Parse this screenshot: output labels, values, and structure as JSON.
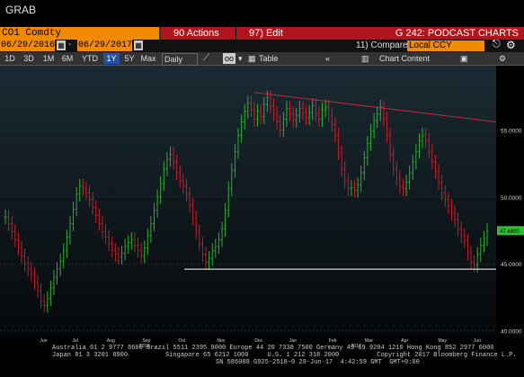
{
  "window": {
    "title": "GRAB"
  },
  "toolbar": {
    "ticker": "CO1 Comdty",
    "actions_label": "90 Actions",
    "edit_label": "97) Edit",
    "page_title": "G 242: PODCAST CHARTS"
  },
  "daterange": {
    "start": "06/29/2016",
    "end": "06/29/2017",
    "compare_label": "11) Compare",
    "currency": "Local CCY"
  },
  "periods": [
    "1D",
    "3D",
    "1M",
    "6M",
    "YTD",
    "1Y",
    "5Y",
    "Max"
  ],
  "active_period": "1Y",
  "frequency": "Daily",
  "chart_tools": {
    "table_label": "Table",
    "chart_content_label": "Chart Content"
  },
  "chart_data": {
    "type": "line",
    "ticks_y": [
      "55.0000",
      "50.0000",
      "45.0000",
      "40.0000"
    ],
    "ylim": [
      39.5,
      59.8
    ],
    "last_price_label": "47.4800",
    "last_price": 47.48,
    "x_months": [
      "Jun",
      "Jul",
      "Aug",
      "Sep",
      "Oct",
      "Nov",
      "Dec",
      "Jan",
      "Feb",
      "Mar",
      "Apr",
      "May",
      "Jun"
    ],
    "x_years": [
      "2016",
      "2017"
    ],
    "resistance_line": {
      "start": 57.8,
      "end": 55.6
    },
    "support_line": 44.6,
    "series": [
      {
        "values": [
          48.5,
          48.0,
          47.4,
          46.8,
          46.2,
          45.6,
          45.0,
          44.6,
          44.2,
          43.6,
          43.0,
          42.2,
          41.9,
          42.4,
          43.2,
          44.0,
          44.6,
          45.2,
          46.0,
          47.0,
          48.0,
          49.1,
          50.2,
          50.8,
          50.6,
          50.3,
          49.8,
          49.2,
          48.6,
          48.0,
          47.4,
          47.0,
          46.5,
          46.0,
          45.7,
          45.5,
          45.8,
          46.3,
          46.6,
          46.8,
          46.4,
          46.0,
          45.6,
          46.2,
          47.1,
          48.0,
          49.0,
          50.0,
          51.0,
          52.1,
          52.8,
          53.2,
          52.6,
          51.8,
          51.2,
          50.8,
          50.2,
          49.4,
          48.4,
          47.4,
          46.5,
          45.7,
          45.1,
          45.4,
          46.0,
          46.3,
          46.8,
          47.6,
          49.0,
          50.6,
          52.0,
          53.4,
          54.6,
          55.6,
          56.4,
          57.0,
          56.5,
          55.8,
          56.4,
          56.0,
          56.9,
          57.4,
          56.8,
          56.2,
          55.6,
          55.0,
          55.8,
          56.6,
          56.2,
          55.7,
          56.1,
          56.6,
          56.3,
          55.9,
          56.3,
          56.8,
          56.2,
          55.8,
          56.5,
          56.7,
          56.1,
          55.4,
          54.6,
          53.3,
          52.1,
          51.2,
          50.6,
          50.7,
          50.5,
          50.9,
          51.8,
          52.9,
          54.0,
          54.9,
          55.7,
          56.2,
          56.7,
          55.8,
          54.6,
          53.2,
          52.1,
          51.4,
          50.8,
          50.6,
          51.1,
          51.8,
          52.6,
          53.4,
          54.2,
          54.6,
          54.2,
          53.4,
          52.6,
          51.9,
          51.1,
          50.3,
          49.8,
          49.3,
          48.8,
          48.3,
          47.6,
          47.1,
          46.7,
          45.8,
          45.1,
          44.9,
          45.7,
          46.4,
          46.9,
          47.48
        ]
      }
    ]
  },
  "footer": {
    "line1": "Australia 61 2 9777 8600 Brazil 5511 2395 9000 Europe 44 20 7330 7500 Germany 49 69 9204 1210 Hong Kong 852 2977 6000",
    "line2": "Japan 81 3 3201 8900          Singapore 65 6212 1000     U.S. 1 212 318 2000          Copyright 2017 Bloomberg Finance L.P.",
    "line3": "SN 586088 G925-2518-0 29-Jun-17  4:42:59 GMT  GMT+0:00"
  },
  "colors": {
    "orange": "#f08a00",
    "red": "#b0141c",
    "up": "#2fbf2f",
    "down": "#d4202a",
    "resistance": "#c8283a",
    "support": "#ffffff"
  }
}
